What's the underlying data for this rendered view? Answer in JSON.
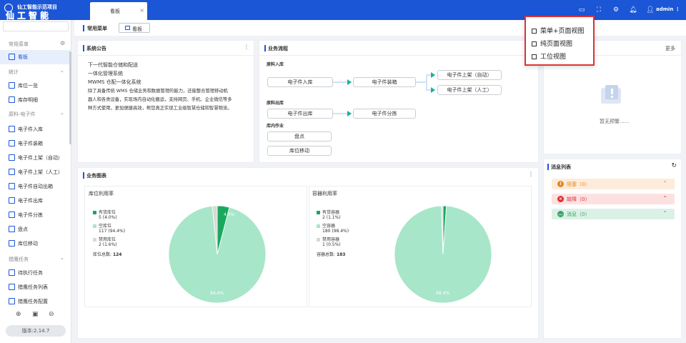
{
  "app": {
    "title": "仙工智能示范项目",
    "logo_text": "仙工智能",
    "active_tab": "看板"
  },
  "header": {
    "user": "admin",
    "icons": [
      "fullscreen-icon",
      "layout-icon",
      "settings-icon",
      "bell-icon",
      "user-icon"
    ]
  },
  "dropdown": {
    "items": [
      "菜单+页面视图",
      "纯页面视图",
      "工位视图"
    ]
  },
  "sidebar": {
    "group_common": "常用菜单",
    "dashboard": "看板",
    "group_stats": "统计",
    "stats_items": [
      "库位一览",
      "库存明细"
    ],
    "group_material": "原料-电子件",
    "material_items": [
      "电子件入库",
      "电子件装箱",
      "电子件上架（自动）",
      "电子件上架（人工）",
      "电子件自动出箱",
      "电子件出库",
      "电子件分拣",
      "盘点",
      "库位移动"
    ],
    "group_tasks": "猎鹰任务",
    "task_items": [
      "待执行任务",
      "猎鹰任务列表",
      "猎鹰任务配置"
    ],
    "version": "版本:2.14.7"
  },
  "quick_bar": {
    "label": "常用菜单",
    "button": "看板"
  },
  "notice": {
    "title": "系统公告",
    "lines": [
      "下一代智能仓储和配送",
      "一体化管理系统",
      "MWMS 仓配一体化系统",
      "除了具备传统 WMS 仓储业务和数据管理的能力，还能整合管理移动机",
      "器人和各类设备，实现场内自动化搬运，支持网页、手机、企业微信等多",
      "种方式使用，更加便捷高效，帮您真正实现工业级智慧仓储和智慧物流。"
    ]
  },
  "workflow": {
    "title": "业务流程",
    "sec_in": "原料入库",
    "sec_out": "原料出库",
    "sec_inner": "库内作业",
    "box_in": "电子件入库",
    "box_pack": "电子件装箱",
    "box_auto": "电子件上架（自动）",
    "box_manual": "电子件上架（人工）",
    "box_out": "电子件出库",
    "box_sort": "电子件分拣",
    "box_check": "盘点",
    "box_move": "库位移动"
  },
  "alerts": {
    "more": "更多",
    "empty": "暂无预警......"
  },
  "charts": {
    "title": "业务图表",
    "left": {
      "title": "库位利用率",
      "legend": [
        {
          "name": "有货库位",
          "detail": "5 (4.0%)",
          "color": "#1aa85c"
        },
        {
          "name": "空库位",
          "detail": "117 (94.4%)",
          "color": "#a8e6c9"
        },
        {
          "name": "禁用库位",
          "detail": "2 (1.6%)",
          "color": "#d9d9d9"
        }
      ],
      "total_label": "库位总数:",
      "total": "124",
      "slice_label_small": "4.0%",
      "slice_label_big": "94.4%"
    },
    "right": {
      "title": "容器利用率",
      "legend": [
        {
          "name": "有货容器",
          "detail": "2 (1.1%)",
          "color": "#1aa85c"
        },
        {
          "name": "空容器",
          "detail": "180 (98.4%)",
          "color": "#a8e6c9"
        },
        {
          "name": "禁用容器",
          "detail": "1 (0.5%)",
          "color": "#d9d9d9"
        }
      ],
      "total_label": "容器总数:",
      "total": "183",
      "slice_label_big": "98.4%"
    }
  },
  "chart_data": [
    {
      "type": "pie",
      "title": "库位利用率",
      "categories": [
        "有货库位",
        "空库位",
        "禁用库位"
      ],
      "values": [
        5,
        117,
        2
      ],
      "colors": [
        "#1aa85c",
        "#a8e6c9",
        "#d9d9d9"
      ]
    },
    {
      "type": "pie",
      "title": "容器利用率",
      "categories": [
        "有货容器",
        "空容器",
        "禁用容器"
      ],
      "values": [
        2,
        180,
        1
      ],
      "colors": [
        "#1aa85c",
        "#a8e6c9",
        "#d9d9d9"
      ]
    }
  ],
  "messages": {
    "title": "消息列表",
    "rows": [
      {
        "label": "阻塞（0）",
        "bg": "#fdecdc",
        "fg": "#e6891c",
        "icon": "!"
      },
      {
        "label": "故障（0）",
        "bg": "#fde1e1",
        "fg": "#d93131",
        "icon": "×"
      },
      {
        "label": "消息（0）",
        "bg": "#dcf1e6",
        "fg": "#3aa56a",
        "icon": "…"
      }
    ]
  }
}
